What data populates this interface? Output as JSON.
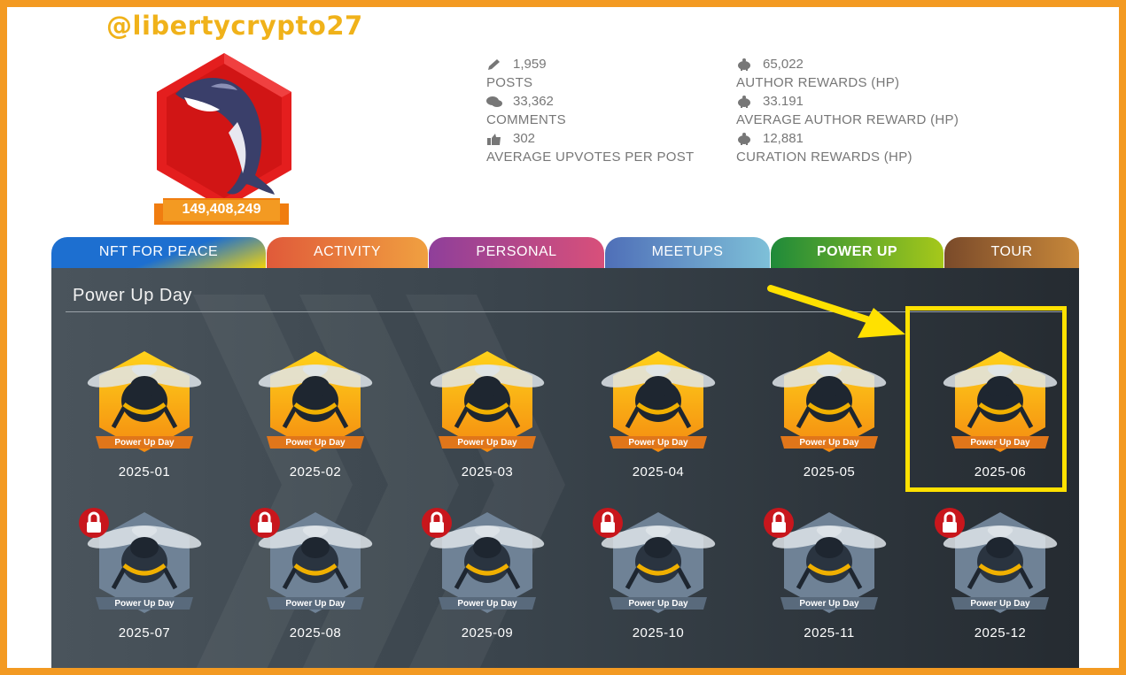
{
  "profile": {
    "username": "@libertycrypto27",
    "score": "149,408,249"
  },
  "stats_left": [
    {
      "icon": "pencil-icon",
      "value": "1,959",
      "label": "POSTS"
    },
    {
      "icon": "comments-icon",
      "value": "33,362",
      "label": "COMMENTS"
    },
    {
      "icon": "thumbs-up-icon",
      "value": "302",
      "label": "AVERAGE UPVOTES PER POST"
    }
  ],
  "stats_right": [
    {
      "icon": "piggy-bank-icon",
      "value": "65,022",
      "label": "AUTHOR REWARDS (HP)"
    },
    {
      "icon": "piggy-bank-icon",
      "value": "33.191",
      "label": "AVERAGE AUTHOR REWARD (HP)"
    },
    {
      "icon": "piggy-bank-icon",
      "value": "12,881",
      "label": "CURATION REWARDS (HP)"
    }
  ],
  "tabs": [
    {
      "label": "NFT FOR PEACE",
      "active": false
    },
    {
      "label": "ACTIVITY",
      "active": false
    },
    {
      "label": "PERSONAL",
      "active": false
    },
    {
      "label": "MEETUPS",
      "active": false
    },
    {
      "label": "POWER UP",
      "active": true
    },
    {
      "label": "TOUR",
      "active": false
    }
  ],
  "panel": {
    "title": "Power Up Day",
    "badge_ribbon": "Power Up Day",
    "unlocked": [
      "2025-01",
      "2025-02",
      "2025-03",
      "2025-04",
      "2025-05",
      "2025-06"
    ],
    "locked": [
      "2025-07",
      "2025-08",
      "2025-09",
      "2025-10",
      "2025-11",
      "2025-12"
    ]
  },
  "colors": {
    "frame": "#f39a22",
    "username": "#f0b21a",
    "highlight": "#ffe100",
    "gold": "#f7b51c",
    "locked": "#6f8296"
  }
}
